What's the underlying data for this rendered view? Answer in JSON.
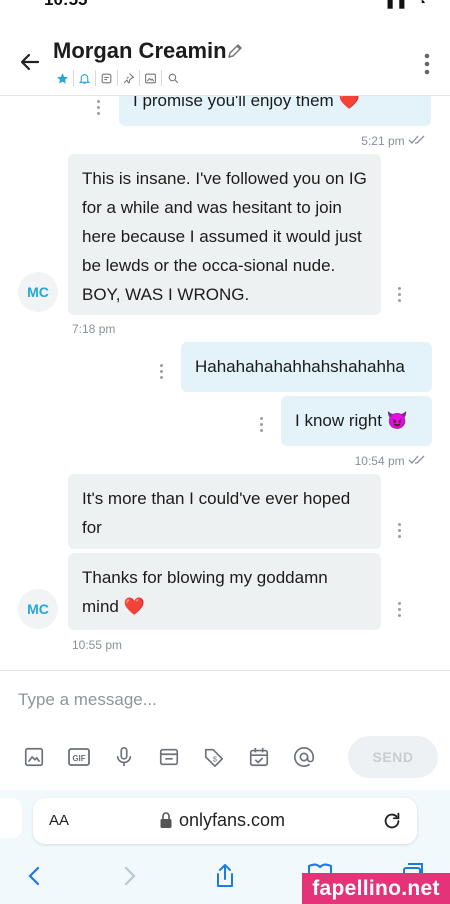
{
  "status_bar": {
    "time": "10:55"
  },
  "header": {
    "contact_name": "Morgan Creamin"
  },
  "messages": [
    {
      "direction": "out",
      "text": "I promise you'll enjoy them ❤️"
    },
    {
      "direction": "out_meta",
      "time": "5:21 pm"
    },
    {
      "direction": "in",
      "avatar": "MC",
      "text": "This is insane. I've followed you on IG for a while and was hesitant to join here because I assumed it would just be lewds or the occa-sional nude. BOY, WAS I WRONG.",
      "time": "7:18 pm"
    },
    {
      "direction": "out",
      "text": "Hahahahahahhahshahahha"
    },
    {
      "direction": "out",
      "text": "I know right 😈",
      "time": "10:54 pm"
    },
    {
      "direction": "in",
      "text": "It's more than I could've ever hoped for"
    },
    {
      "direction": "in",
      "avatar": "MC",
      "text": "Thanks for blowing my goddamn mind ❤️",
      "time": "10:55 pm"
    }
  ],
  "composer": {
    "placeholder": "Type a message...",
    "send_label": "SEND",
    "tools": [
      "image-icon",
      "gif-icon",
      "microphone-icon",
      "vault-icon",
      "price-tag-icon",
      "calendar-icon",
      "mention-icon"
    ]
  },
  "browser": {
    "text_size_label": "AA",
    "domain": "onlyfans.com"
  },
  "watermark": "fapellino.net",
  "colors": {
    "accent": "#27a6d9",
    "incoming_bubble": "#eef1f2",
    "outgoing_bubble": "#e3f3f9",
    "watermark": "#e5337a"
  }
}
